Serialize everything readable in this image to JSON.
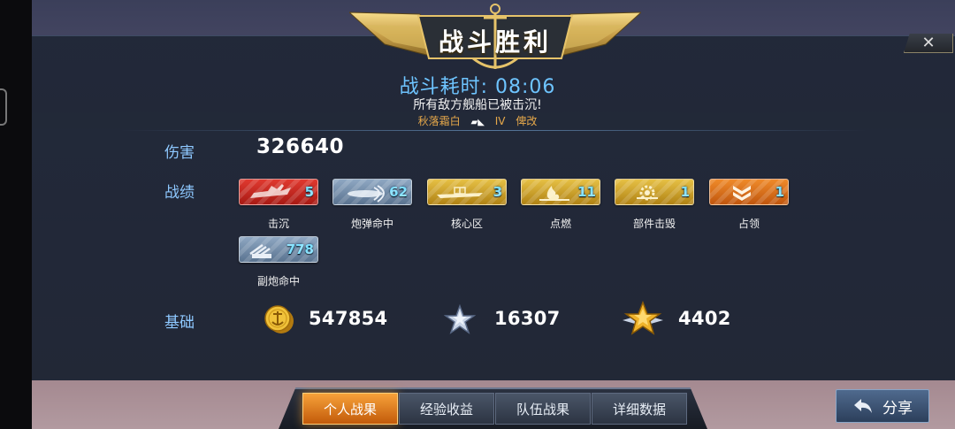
{
  "title": "战斗胜利",
  "close_icon": "✕",
  "battle": {
    "time_label": "战斗耗时: 08:06",
    "subtitle": "所有敌方舰船已被击沉!",
    "ship_name": "秋落霜白",
    "ship_tier": "IV",
    "ship_type": "俾改"
  },
  "damage": {
    "label": "伤害",
    "value": "326640"
  },
  "achievements": {
    "label": "战绩",
    "items": [
      {
        "label": "击沉",
        "count": "5",
        "style": "red",
        "icon": "sunk-ship-icon"
      },
      {
        "label": "炮弹命中",
        "count": "62",
        "style": "steel",
        "icon": "shell-hit-icon"
      },
      {
        "label": "核心区",
        "count": "3",
        "style": "gold",
        "icon": "citadel-icon"
      },
      {
        "label": "点燃",
        "count": "11",
        "style": "gold",
        "icon": "fire-icon"
      },
      {
        "label": "部件击毁",
        "count": "1",
        "style": "gold",
        "icon": "module-destroyed-icon"
      },
      {
        "label": "占领",
        "count": "1",
        "style": "orange",
        "icon": "capture-icon"
      },
      {
        "label": "副炮命中",
        "count": "778",
        "style": "steel",
        "icon": "secondary-hit-icon"
      }
    ]
  },
  "base": {
    "label": "基础",
    "credits": "547854",
    "experience": "16307",
    "commander_exp": "4402"
  },
  "tabs": [
    "个人战果",
    "经验收益",
    "队伍战果",
    "详细数据"
  ],
  "active_tab": 0,
  "share": {
    "label": "分享"
  },
  "colors": {
    "accent_blue": "#6ec4ff",
    "label_blue": "#8ec8ff",
    "ship_orange": "#e6a84a",
    "tab_active": "#f7a23a"
  }
}
